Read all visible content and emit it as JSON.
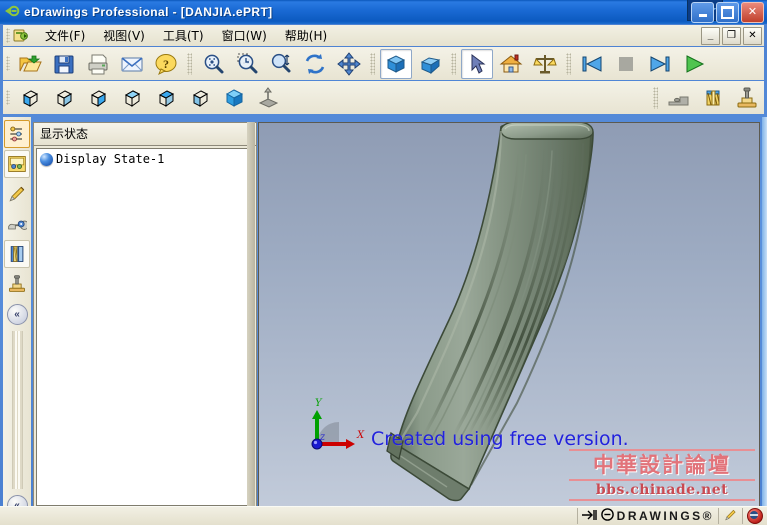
{
  "window": {
    "title": "eDrawings Professional - [DANJIA.ePRT]",
    "app_icon": "edrawings-logo-icon",
    "controls": {
      "minimize": "minimize-button",
      "maximize": "maximize-button",
      "close": "close-button",
      "close_glyph": "✕"
    },
    "mdi_controls": {
      "minimize_glyph": "_",
      "restore_glyph": "❐",
      "close_glyph": "✕"
    }
  },
  "menubar": {
    "doc_icon": "document-icon",
    "items": [
      {
        "label": "文件(F)",
        "name": "menu-file"
      },
      {
        "label": "视图(V)",
        "name": "menu-view"
      },
      {
        "label": "工具(T)",
        "name": "menu-tools"
      },
      {
        "label": "窗口(W)",
        "name": "menu-window"
      },
      {
        "label": "帮助(H)",
        "name": "menu-help"
      }
    ]
  },
  "toolbar_main": {
    "buttons": [
      {
        "name": "open-button",
        "icon": "open-folder-icon",
        "pressed": false
      },
      {
        "name": "save-button",
        "icon": "floppy-save-icon",
        "pressed": false
      },
      {
        "name": "print-button",
        "icon": "printer-icon",
        "pressed": false
      },
      {
        "name": "email-button",
        "icon": "envelope-icon",
        "pressed": false
      },
      {
        "name": "help-button",
        "icon": "question-mark-icon",
        "pressed": false
      },
      {
        "name": "zoom-to-fit-button",
        "icon": "magnifier-fit-icon",
        "pressed": false
      },
      {
        "name": "zoom-to-area-button",
        "icon": "magnifier-area-icon",
        "pressed": false
      },
      {
        "name": "zoom-in-out-button",
        "icon": "magnifier-updown-icon",
        "pressed": false
      },
      {
        "name": "rotate-button",
        "icon": "rotate-arrows-icon",
        "pressed": false
      },
      {
        "name": "pan-button",
        "icon": "pan-move-icon",
        "pressed": false
      },
      {
        "name": "shaded-view-button",
        "icon": "blue-cube-icon",
        "pressed": true
      },
      {
        "name": "perspective-view-button",
        "icon": "blue-prism-icon",
        "pressed": false
      },
      {
        "name": "select-button",
        "icon": "arrow-cursor-icon",
        "pressed": true
      },
      {
        "name": "home-view-button",
        "icon": "house-icon",
        "pressed": false
      },
      {
        "name": "measure-button",
        "icon": "balance-scale-icon",
        "pressed": false
      },
      {
        "name": "first-frame-button",
        "icon": "skip-previous-icon",
        "pressed": false
      },
      {
        "name": "stop-button",
        "icon": "stop-square-icon",
        "pressed": false
      },
      {
        "name": "last-frame-button",
        "icon": "skip-next-icon",
        "pressed": false
      },
      {
        "name": "play-button",
        "icon": "play-triangle-icon",
        "pressed": false
      }
    ]
  },
  "toolbar_views": {
    "buttons": [
      {
        "name": "view-front-button",
        "icon": "cube-front-icon"
      },
      {
        "name": "view-back-button",
        "icon": "cube-back-icon"
      },
      {
        "name": "view-left-button",
        "icon": "cube-left-icon"
      },
      {
        "name": "view-right-button",
        "icon": "cube-right-icon"
      },
      {
        "name": "view-top-button",
        "icon": "cube-top-icon"
      },
      {
        "name": "view-bottom-button",
        "icon": "cube-bottom-icon"
      },
      {
        "name": "view-isometric-button",
        "icon": "cube-solid-icon"
      },
      {
        "name": "normal-to-button",
        "icon": "normal-to-arrow-icon"
      }
    ],
    "right_buttons": [
      {
        "name": "section-view-button",
        "icon": "section-plane-icon"
      },
      {
        "name": "cross-section-button",
        "icon": "hatched-cylinder-icon"
      },
      {
        "name": "stamp-button",
        "icon": "rubber-stamp-icon"
      }
    ]
  },
  "left_toolbar": {
    "buttons": [
      {
        "name": "configurations-tab",
        "icon": "component-tree-icon",
        "state": "selected"
      },
      {
        "name": "display-states-tab",
        "icon": "display-states-icon",
        "state": "boxed"
      },
      {
        "name": "markup-tab",
        "icon": "pencil-markup-icon",
        "state": "normal"
      },
      {
        "name": "measure-tab",
        "icon": "tape-measure-icon",
        "state": "normal"
      },
      {
        "name": "section-tab",
        "icon": "section-book-icon",
        "state": "boxed"
      },
      {
        "name": "stamp-tab",
        "icon": "rubber-stamp-icon",
        "state": "normal"
      }
    ],
    "collapse_top": {
      "name": "collapse-panel-top-button",
      "glyph": "«"
    },
    "collapse_bottom": {
      "name": "collapse-panel-bottom-button",
      "glyph": "«"
    }
  },
  "tree_panel": {
    "header": "显示状态",
    "items": [
      {
        "label": "Display State-1",
        "icon": "blue-sphere-icon"
      }
    ]
  },
  "viewport": {
    "watermark_text": "Created using free version.",
    "watermark_color": "#2222dd",
    "model_name": "curved-magazine-3d-model",
    "model_color": "#7a8a7a",
    "background_top": "#8f9cb4",
    "background_bottom": "#c2cbda",
    "triad": {
      "x_label": "X",
      "y_label": "Y",
      "z_label": "Z",
      "x_color": "#cc0000",
      "y_color": "#00a000",
      "z_color": "#0000cc"
    }
  },
  "forum_watermark": {
    "chinese": "中華設計論壇",
    "url": "bbs.chinade.net",
    "color": "#d8636b"
  },
  "statusbar": {
    "arrow_icon": "arrow-right-icon",
    "logo_text": "DRAWINGS®",
    "logo_mark": "e",
    "pencil_icon": "pencil-icon",
    "red_icon": "no-entry-icon"
  }
}
